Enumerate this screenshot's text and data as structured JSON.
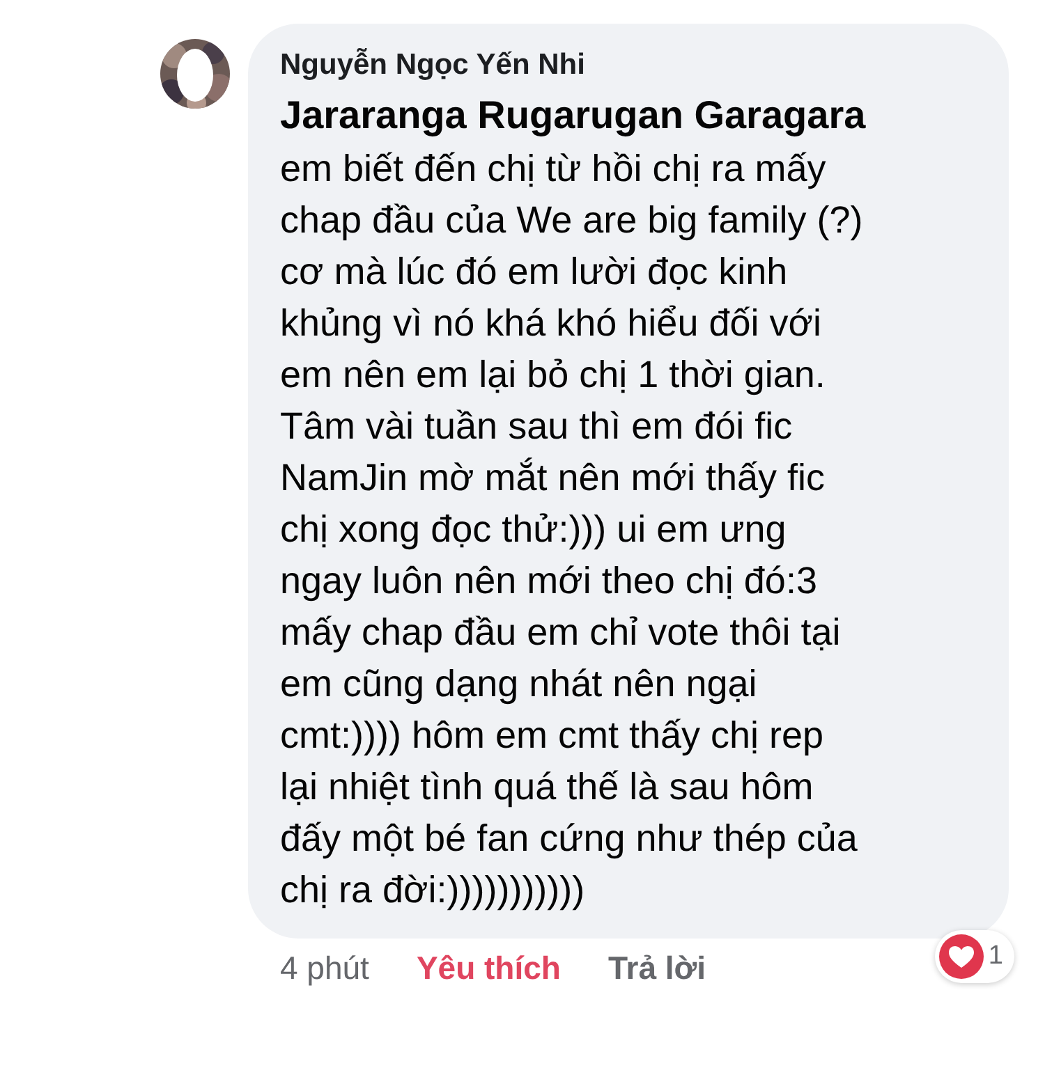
{
  "comment": {
    "author": "Nguyễn Ngọc Yến Nhi",
    "tagged": "Jararanga Rugarugan Garagara",
    "lines": [
      "em biết đến chị từ hồi chị ra mấy",
      "chap đầu của We are big family (?)",
      "cơ mà lúc đó em lười đọc kinh",
      "khủng vì nó khá khó hiểu đối với",
      "em nên em lại bỏ chị 1 thời gian.",
      "Tâm vài tuần sau thì em đói fic",
      "NamJin mờ mắt nên mới thấy fic",
      "chị xong đọc thử:))) ui em ưng",
      "ngay luôn nên mới theo chị đó:3",
      "mấy chap đầu em chỉ vote thôi tại",
      "em cũng dạng nhát nên ngại",
      "cmt:)))) hôm em cmt thấy chị rep",
      "lại nhiệt tình quá thế là sau hôm",
      "đấy một bé fan cứng như thép của",
      "chị ra đời:)))))))))))"
    ],
    "time": "4 phút",
    "like": {
      "label": "Yêu thích",
      "selected": true
    },
    "reply": "Trả lời",
    "reaction_count": "1"
  }
}
